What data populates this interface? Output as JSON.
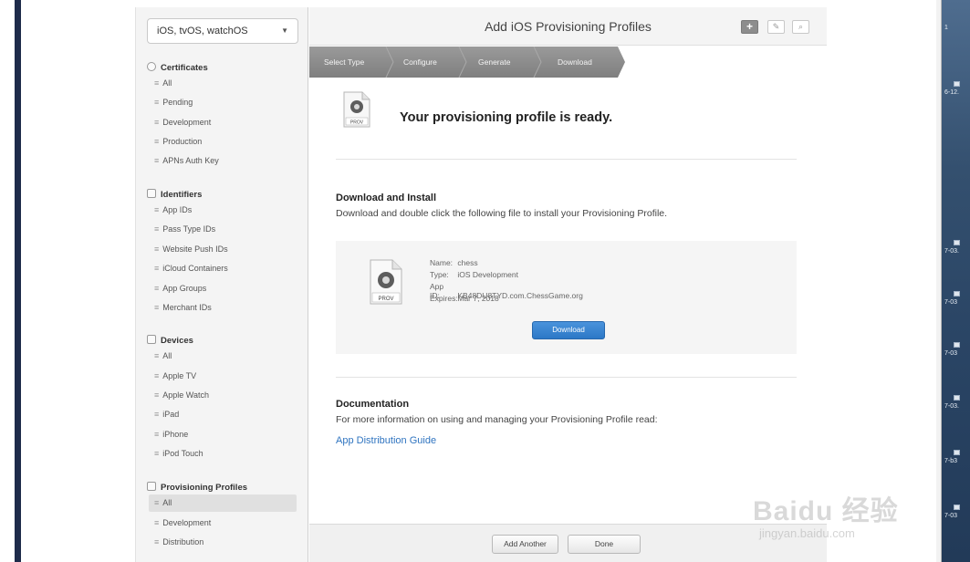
{
  "sidebar": {
    "platform": "iOS, tvOS, watchOS",
    "sections": {
      "certificates": {
        "label": "Certificates",
        "items": [
          "All",
          "Pending",
          "Development",
          "Production",
          "APNs Auth Key"
        ]
      },
      "identifiers": {
        "label": "Identifiers",
        "items": [
          "App IDs",
          "Pass Type IDs",
          "Website Push IDs",
          "iCloud Containers",
          "App Groups",
          "Merchant IDs"
        ]
      },
      "devices": {
        "label": "Devices",
        "items": [
          "All",
          "Apple TV",
          "Apple Watch",
          "iPad",
          "iPhone",
          "iPod Touch"
        ]
      },
      "profiles": {
        "label": "Provisioning Profiles",
        "items": [
          "All",
          "Development",
          "Distribution"
        ],
        "selected": "All"
      }
    }
  },
  "header": {
    "title": "Add iOS Provisioning Profiles",
    "add_icon_label": "+"
  },
  "steps": [
    "Select Type",
    "Configure",
    "Generate",
    "Download"
  ],
  "ready": {
    "icon_label": "PROV",
    "message": "Your provisioning profile is ready."
  },
  "install": {
    "heading": "Download and Install",
    "description": "Download and double click the following file to install your Provisioning Profile.",
    "file": {
      "icon_label": "PROV",
      "name_key": "Name:",
      "name": "chess",
      "type_key": "Type:",
      "type": "iOS Development",
      "appid_key": "App ID:",
      "appid": "KB48DU8TYD.com.ChessGame.org",
      "expires_key": "Expires:",
      "expires": "Mar 7, 2018"
    },
    "download_label": "Download"
  },
  "docs": {
    "heading": "Documentation",
    "description": "For more information on using and managing your Provisioning Profile read:",
    "link": "App Distribution Guide"
  },
  "footer": {
    "add_another": "Add Another",
    "done": "Done"
  },
  "watermark": {
    "main": "Baidu 经验",
    "sub": "jingyan.baidu.com"
  },
  "dock": [
    "1",
    "6-12.",
    "7-03.",
    "7-03",
    "7-03",
    "7-03.",
    "7-b3",
    "7-03"
  ]
}
